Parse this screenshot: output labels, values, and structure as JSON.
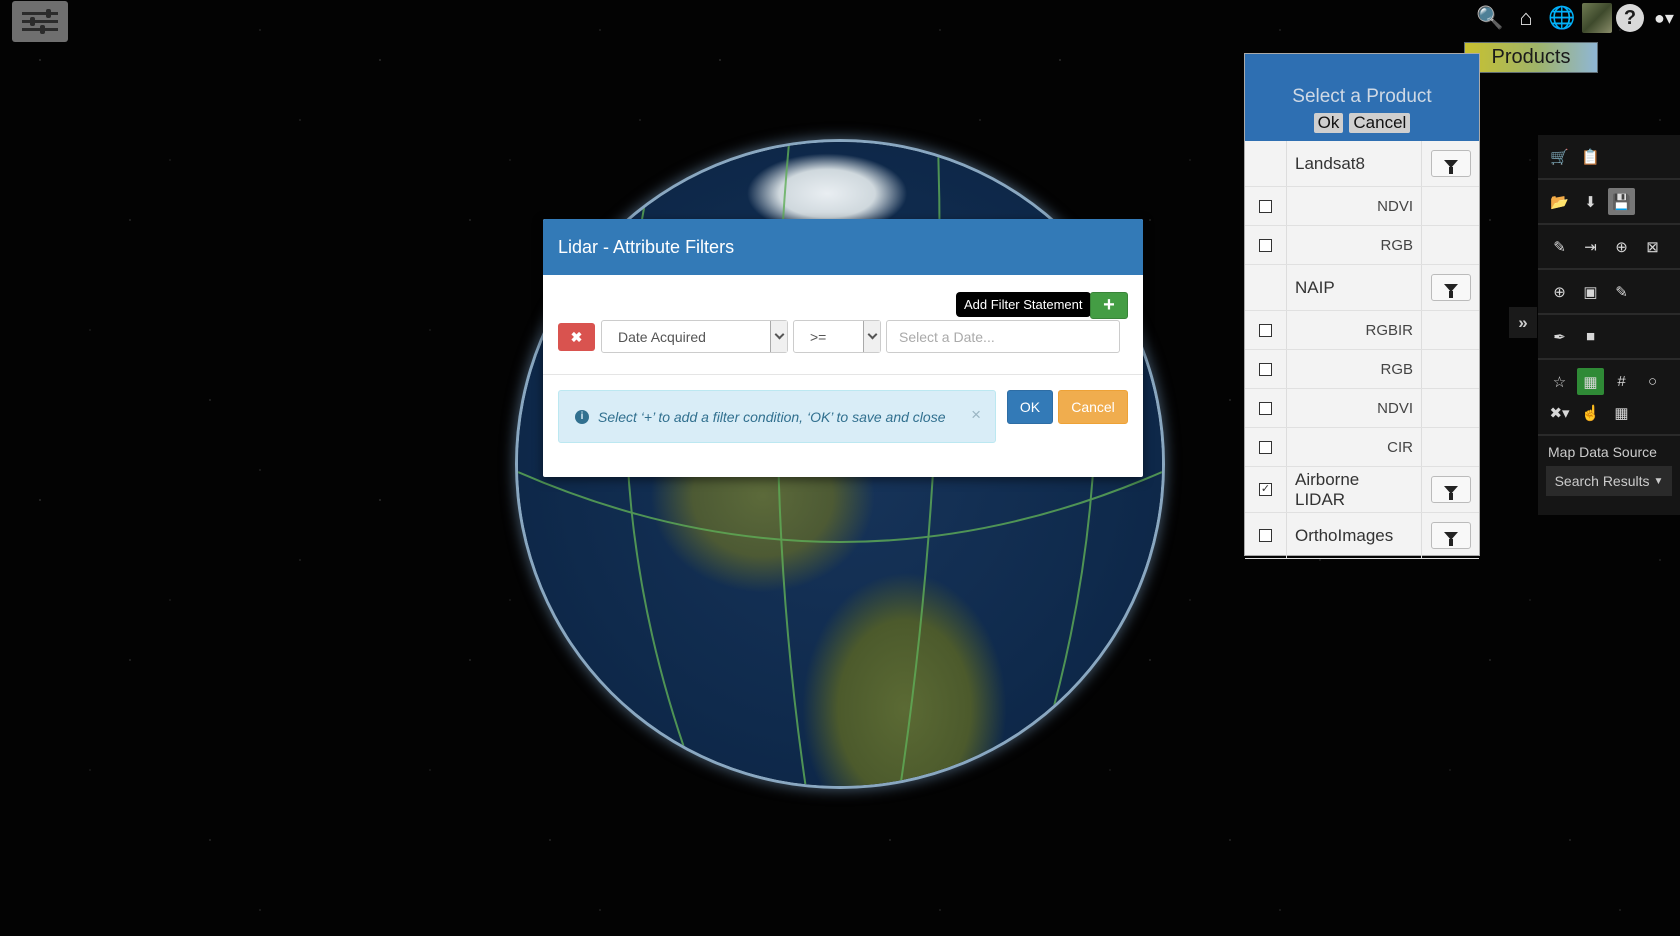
{
  "toolbar": {
    "icons": [
      "search-icon",
      "home-icon",
      "globe-icon",
      "imagery-icon",
      "help-icon",
      "user-icon"
    ],
    "help_label": "?",
    "products_label": "Products"
  },
  "product_panel": {
    "title": "Select a Product",
    "ok_label": "Ok",
    "cancel_label": "Cancel",
    "rows": [
      {
        "label": "Landsat8",
        "type": "group",
        "checked": false
      },
      {
        "label": "NDVI",
        "type": "item",
        "checked": false
      },
      {
        "label": "RGB",
        "type": "item",
        "checked": false
      },
      {
        "label": "NAIP",
        "type": "group",
        "checked": false
      },
      {
        "label": "RGBIR",
        "type": "item",
        "checked": false
      },
      {
        "label": "RGB",
        "type": "item",
        "checked": false
      },
      {
        "label": "NDVI",
        "type": "item",
        "checked": false
      },
      {
        "label": "CIR",
        "type": "item",
        "checked": false
      },
      {
        "label": "Airborne LIDAR",
        "type": "group",
        "checked": true
      },
      {
        "label": "OrthoImages",
        "type": "group",
        "checked": false
      }
    ]
  },
  "side_tools": {
    "map_data_source_label": "Map Data Source",
    "search_results_label": "Search Results"
  },
  "modal": {
    "title": "Lidar - Attribute Filters",
    "tooltip": "Add Filter Statement",
    "add_label": "+",
    "attribute_value": "Date Acquired",
    "operator_value": ">=",
    "date_placeholder": "Select a Date...",
    "hint": "Select ‘+’ to add a filter condition, ‘OK’ to save and close",
    "ok_label": "OK",
    "cancel_label": "Cancel"
  },
  "colors": {
    "modal_header": "#337ab7",
    "add_button": "#449d44",
    "remove_button": "#d9534f",
    "cancel_button": "#f0ad4e"
  }
}
